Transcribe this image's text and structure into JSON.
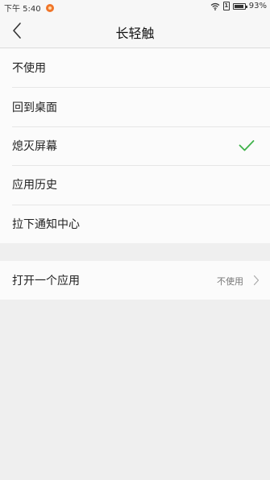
{
  "status_bar": {
    "time": "下午 5:40",
    "sim_label": "1",
    "battery": "93%",
    "battery_level": 0.93
  },
  "header": {
    "title": "长轻触"
  },
  "options": [
    {
      "label": "不使用",
      "selected": false
    },
    {
      "label": "回到桌面",
      "selected": false
    },
    {
      "label": "熄灭屏幕",
      "selected": true
    },
    {
      "label": "应用历史",
      "selected": false
    },
    {
      "label": "拉下通知中心",
      "selected": false
    }
  ],
  "open_app": {
    "label": "打开一个应用",
    "value": "不使用"
  },
  "colors": {
    "check": "#3fb24a",
    "background": "#efefef",
    "row_bg": "#fbfbfb"
  }
}
